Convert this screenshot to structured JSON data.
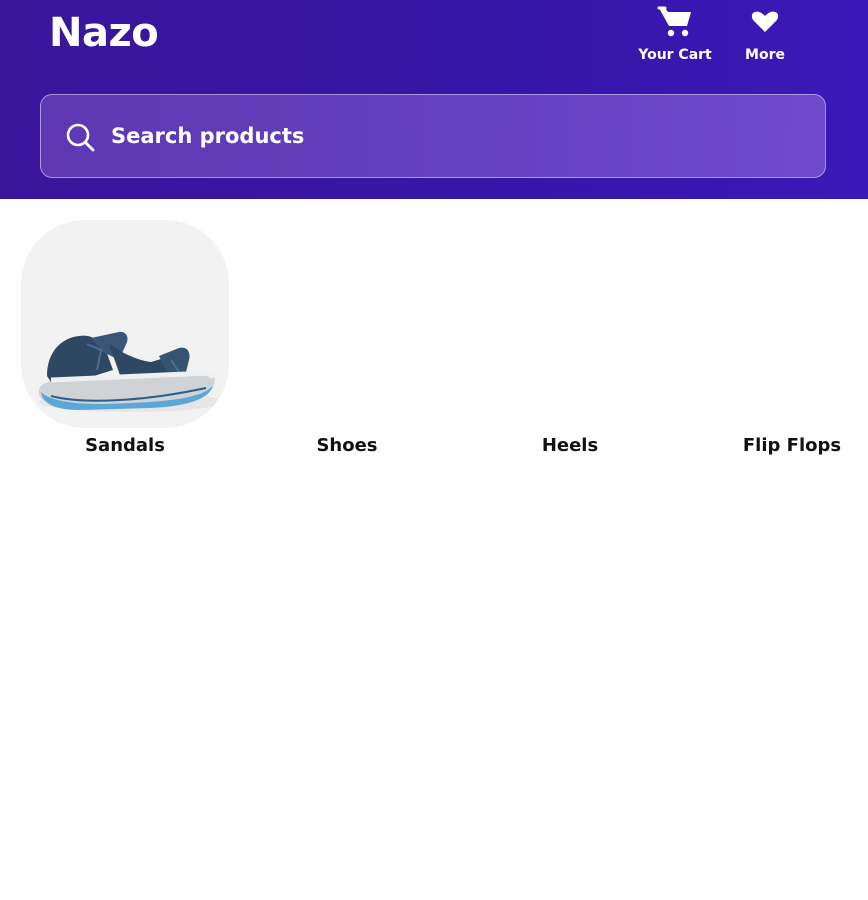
{
  "app": {
    "name": "Nazo"
  },
  "header": {
    "cart": {
      "label": "Your Cart",
      "icon": "cart-icon"
    },
    "more": {
      "label": "More",
      "icon": "heart-icon"
    }
  },
  "search": {
    "placeholder": "Search products",
    "value": "",
    "icon": "search-icon"
  },
  "categories": [
    {
      "label": "Sandals",
      "image": "sandal-image"
    },
    {
      "label": "Shoes",
      "image": ""
    },
    {
      "label": "Heels",
      "image": ""
    },
    {
      "label": "Flip Flops",
      "image": ""
    }
  ],
  "colors": {
    "header_bg": "#3616a6",
    "text_on_header": "#ffffff",
    "category_bg": "#f2f2f2"
  }
}
